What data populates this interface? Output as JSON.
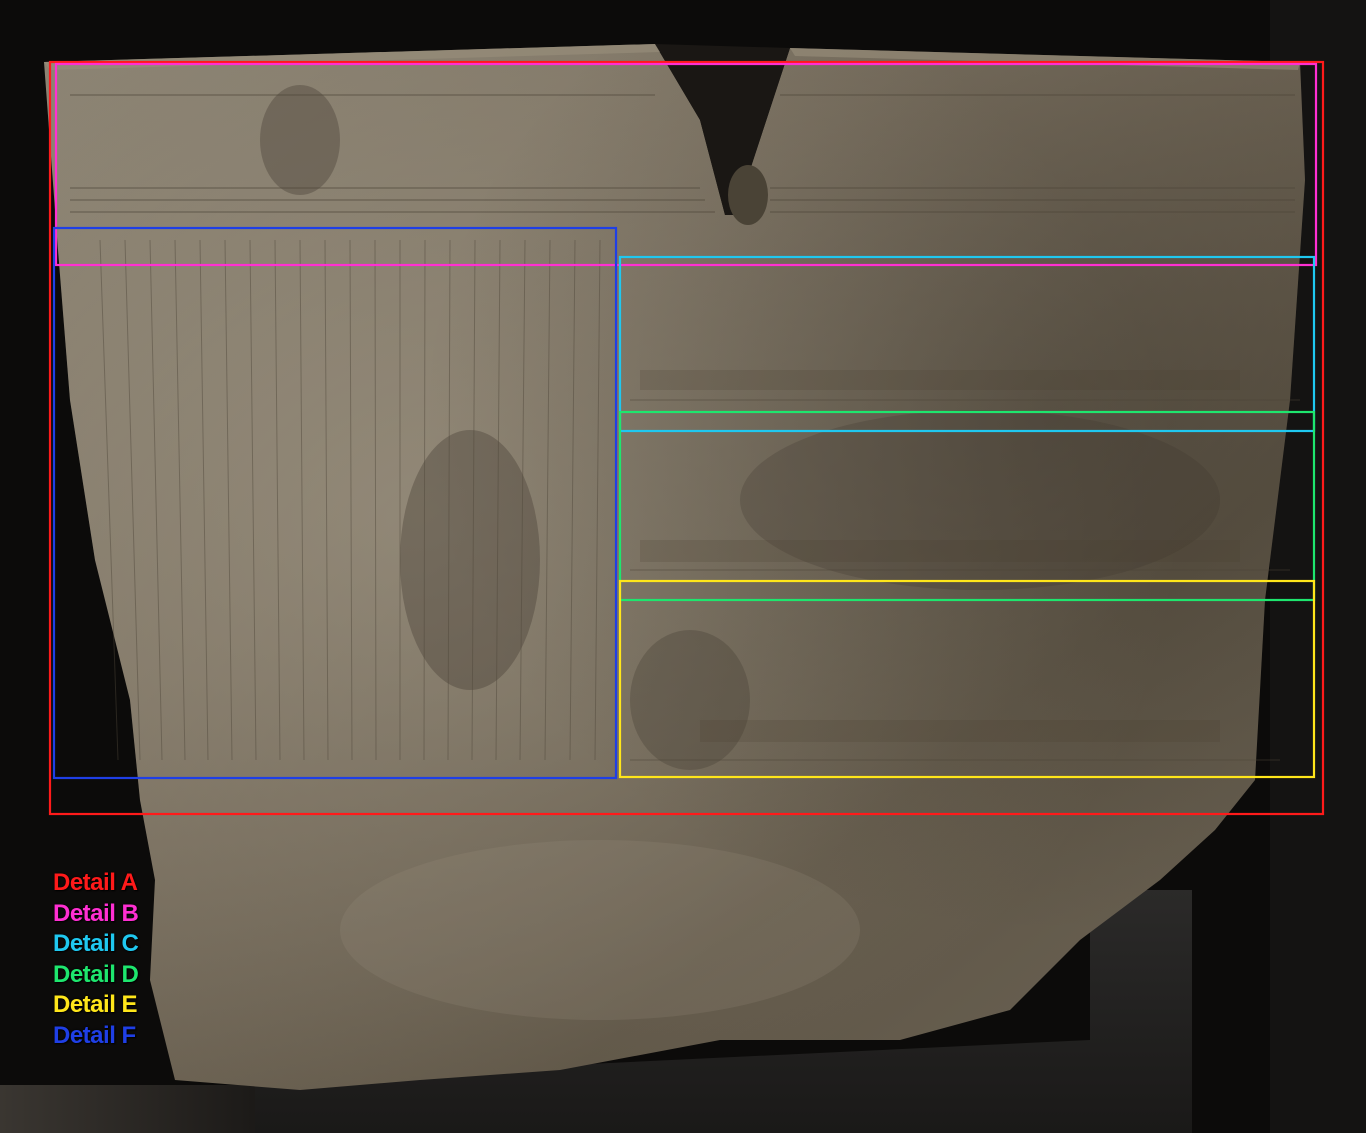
{
  "legend": [
    {
      "label": "Detail A",
      "color": "#ff1a1a"
    },
    {
      "label": "Detail B",
      "color": "#ff2fd2"
    },
    {
      "label": "Detail C",
      "color": "#1fc8f0"
    },
    {
      "label": "Detail D",
      "color": "#1ee66e"
    },
    {
      "label": "Detail E",
      "color": "#ffe61a"
    },
    {
      "label": "Detail F",
      "color": "#1f3fe6"
    }
  ]
}
